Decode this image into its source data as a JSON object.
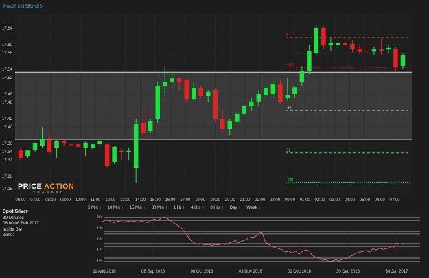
{
  "top_links": [
    "PIVOT LINES",
    "ZONES"
  ],
  "logo": {
    "line1": "PRICE ACTION",
    "line2": "TRACKER"
  },
  "info": {
    "symbol": "Spot Silver",
    "timeframe": "30 Minutes",
    "datetime": "08:00 06 Feb 2017",
    "pattern": "Inside Bar",
    "zone": "Zone: -"
  },
  "timeframes": [
    {
      "label": "5 Min",
      "dir": "down"
    },
    {
      "label": "10 Min",
      "dir": "down"
    },
    {
      "label": "15 Min",
      "dir": "down"
    },
    {
      "label": "30 Min",
      "dir": "up"
    },
    {
      "label": "1 Hr",
      "dir": "up"
    },
    {
      "label": "4 Hrs",
      "dir": "up"
    },
    {
      "label": "8 Hrs",
      "dir": "up"
    },
    {
      "label": "Day",
      "dir": "up"
    },
    {
      "label": "Week",
      "dir": "down"
    }
  ],
  "colors": {
    "up": "#22dd44",
    "down": "#e02424",
    "bg": "#1c1c1c",
    "zone": "#3a3a3a",
    "grid": "#2b2b2b",
    "axis": "#d0d0d0",
    "link": "#4aa3df",
    "mini_line": "#e86a6a"
  },
  "chart_data": [
    {
      "type": "candlestick",
      "title": "",
      "y_ticks": [
        17.25,
        17.28,
        17.32,
        17.34,
        17.36,
        17.4,
        17.42,
        17.46,
        17.48,
        17.52,
        17.54,
        17.58,
        17.6,
        17.64
      ],
      "ylim": [
        17.235,
        17.675
      ],
      "x_ticks": [
        "06:00",
        "07:00",
        "08:00",
        "09:00",
        "10:00",
        "11:00",
        "12:00",
        "13:00",
        "14:00",
        "15:00",
        "16:00",
        "17:00",
        "18:00",
        "19:00",
        "20:00",
        "21:00",
        "22:00",
        "23:00",
        "00:00",
        "01:00",
        "02:00",
        "03:00",
        "04:00",
        "05:00",
        "06:00",
        "07:00"
      ],
      "grid": true,
      "zone": {
        "low": 17.37,
        "high": 17.533
      },
      "levels": [
        {
          "label": "R1",
          "value": 17.617,
          "color": "#e02424",
          "style": "dashed"
        },
        {
          "label": "High",
          "value": 17.545,
          "color": "#e02424",
          "style": "dotted"
        },
        {
          "label": "Piv",
          "value": 17.44,
          "color": "#dddddd",
          "style": "dashed"
        },
        {
          "label": "S1",
          "value": 17.337,
          "color": "#22dd44",
          "style": "dashed"
        },
        {
          "label": "Low",
          "value": 17.266,
          "color": "#22dd44",
          "style": "dotted"
        }
      ],
      "candles": [
        {
          "o": 17.345,
          "h": 17.35,
          "l": 17.32,
          "c": 17.325
        },
        {
          "o": 17.33,
          "h": 17.345,
          "l": 17.325,
          "c": 17.343
        },
        {
          "o": 17.345,
          "h": 17.362,
          "l": 17.34,
          "c": 17.36
        },
        {
          "o": 17.355,
          "h": 17.4,
          "l": 17.35,
          "c": 17.37
        },
        {
          "o": 17.368,
          "h": 17.385,
          "l": 17.335,
          "c": 17.34
        },
        {
          "o": 17.35,
          "h": 17.368,
          "l": 17.325,
          "c": 17.365
        },
        {
          "o": 17.365,
          "h": 17.368,
          "l": 17.355,
          "c": 17.36
        },
        {
          "o": 17.358,
          "h": 17.362,
          "l": 17.352,
          "c": 17.356
        },
        {
          "o": 17.358,
          "h": 17.362,
          "l": 17.35,
          "c": 17.352
        },
        {
          "o": 17.35,
          "h": 17.365,
          "l": 17.33,
          "c": 17.362
        },
        {
          "o": 17.35,
          "h": 17.362,
          "l": 17.345,
          "c": 17.358
        },
        {
          "o": 17.358,
          "h": 17.37,
          "l": 17.35,
          "c": 17.365
        },
        {
          "o": 17.358,
          "h": 17.36,
          "l": 17.3,
          "c": 17.305
        },
        {
          "o": 17.315,
          "h": 17.355,
          "l": 17.31,
          "c": 17.352
        },
        {
          "o": 17.342,
          "h": 17.348,
          "l": 17.32,
          "c": 17.34
        },
        {
          "o": 17.34,
          "h": 17.35,
          "l": 17.32,
          "c": 17.342
        },
        {
          "o": 17.3,
          "h": 17.42,
          "l": 17.265,
          "c": 17.408
        },
        {
          "o": 17.41,
          "h": 17.455,
          "l": 17.38,
          "c": 17.385
        },
        {
          "o": 17.39,
          "h": 17.42,
          "l": 17.385,
          "c": 17.415
        },
        {
          "o": 17.42,
          "h": 17.51,
          "l": 17.41,
          "c": 17.5
        },
        {
          "o": 17.5,
          "h": 17.548,
          "l": 17.48,
          "c": 17.51
        },
        {
          "o": 17.51,
          "h": 17.535,
          "l": 17.5,
          "c": 17.518
        },
        {
          "o": 17.518,
          "h": 17.52,
          "l": 17.49,
          "c": 17.508
        },
        {
          "o": 17.515,
          "h": 17.518,
          "l": 17.46,
          "c": 17.468
        },
        {
          "o": 17.468,
          "h": 17.51,
          "l": 17.46,
          "c": 17.495
        },
        {
          "o": 17.495,
          "h": 17.5,
          "l": 17.47,
          "c": 17.475
        },
        {
          "o": 17.475,
          "h": 17.49,
          "l": 17.46,
          "c": 17.485
        },
        {
          "o": 17.49,
          "h": 17.495,
          "l": 17.41,
          "c": 17.42
        },
        {
          "o": 17.42,
          "h": 17.44,
          "l": 17.385,
          "c": 17.395
        },
        {
          "o": 17.395,
          "h": 17.42,
          "l": 17.38,
          "c": 17.415
        },
        {
          "o": 17.412,
          "h": 17.44,
          "l": 17.408,
          "c": 17.432
        },
        {
          "o": 17.432,
          "h": 17.455,
          "l": 17.425,
          "c": 17.45
        },
        {
          "o": 17.45,
          "h": 17.47,
          "l": 17.44,
          "c": 17.462
        },
        {
          "o": 17.462,
          "h": 17.49,
          "l": 17.45,
          "c": 17.48
        },
        {
          "o": 17.478,
          "h": 17.5,
          "l": 17.468,
          "c": 17.495
        },
        {
          "o": 17.48,
          "h": 17.512,
          "l": 17.47,
          "c": 17.505
        },
        {
          "o": 17.505,
          "h": 17.515,
          "l": 17.455,
          "c": 17.46
        },
        {
          "o": 17.47,
          "h": 17.52,
          "l": 17.465,
          "c": 17.478
        },
        {
          "o": 17.48,
          "h": 17.5,
          "l": 17.47,
          "c": 17.496
        },
        {
          "o": 17.51,
          "h": 17.548,
          "l": 17.5,
          "c": 17.535
        },
        {
          "o": 17.535,
          "h": 17.6,
          "l": 17.528,
          "c": 17.585
        },
        {
          "o": 17.58,
          "h": 17.648,
          "l": 17.575,
          "c": 17.64
        },
        {
          "o": 17.64,
          "h": 17.645,
          "l": 17.59,
          "c": 17.598
        },
        {
          "o": 17.598,
          "h": 17.615,
          "l": 17.585,
          "c": 17.605
        },
        {
          "o": 17.6,
          "h": 17.612,
          "l": 17.59,
          "c": 17.605
        },
        {
          "o": 17.605,
          "h": 17.608,
          "l": 17.598,
          "c": 17.6
        },
        {
          "o": 17.602,
          "h": 17.61,
          "l": 17.58,
          "c": 17.59
        },
        {
          "o": 17.59,
          "h": 17.6,
          "l": 17.578,
          "c": 17.582
        },
        {
          "o": 17.585,
          "h": 17.6,
          "l": 17.578,
          "c": 17.583
        },
        {
          "o": 17.583,
          "h": 17.595,
          "l": 17.575,
          "c": 17.588
        },
        {
          "o": 17.588,
          "h": 17.615,
          "l": 17.575,
          "c": 17.585
        },
        {
          "o": 17.588,
          "h": 17.6,
          "l": 17.58,
          "c": 17.592
        },
        {
          "o": 17.59,
          "h": 17.595,
          "l": 17.535,
          "c": 17.545
        },
        {
          "o": 17.548,
          "h": 17.58,
          "l": 17.54,
          "c": 17.575
        }
      ]
    },
    {
      "type": "line",
      "title": "",
      "x_ticks": [
        "11 Aug 2016",
        "08 Sep 2016",
        "06 Oct 2016",
        "03 Nov 2016",
        "01 Dec 2016",
        "30 Dec 2016",
        "30 Jan 2017"
      ],
      "y_ticks": [
        16,
        17,
        18,
        19,
        20
      ],
      "ylim": [
        15.5,
        20.25
      ],
      "bands": [
        19.95,
        19.68,
        18.68,
        18.45,
        17.57,
        17.3,
        16.25,
        15.95
      ],
      "values": [
        19.5,
        19.65,
        19.75,
        19.55,
        19.45,
        19.6,
        19.55,
        19.5,
        19.6,
        19.55,
        19.6,
        19.5,
        19.6,
        19.55,
        19.45,
        19.7,
        19.8,
        19.65,
        19.9,
        20.0,
        19.8,
        19.6,
        19.4,
        19.2,
        19.0,
        18.6,
        18.2,
        17.8,
        17.6,
        17.5,
        17.55,
        17.45,
        17.5,
        17.4,
        17.5,
        17.45,
        17.55,
        17.5,
        17.6,
        17.7,
        17.85,
        17.65,
        17.8,
        17.9,
        18.1,
        18.15,
        18.2,
        18.55,
        18.6,
        17.7,
        17.5,
        17.3,
        17.2,
        17.1,
        17.0,
        16.8,
        16.9,
        16.7,
        16.9,
        16.6,
        16.85,
        17.0,
        16.9,
        16.5,
        16.35,
        16.3,
        16.05,
        16.1,
        15.95,
        16.0,
        16.1,
        16.0,
        16.15,
        16.2,
        16.4,
        16.5,
        16.7,
        16.8,
        16.85,
        16.95,
        16.8,
        17.1,
        17.0,
        17.15,
        17.05,
        17.1,
        17.2,
        17.15,
        17.6,
        17.55,
        17.5,
        17.6
      ]
    }
  ]
}
